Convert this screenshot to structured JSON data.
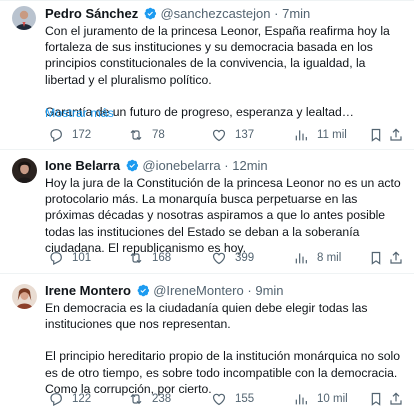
{
  "tweets": [
    {
      "name": "Pedro Sánchez",
      "handle": "@sanchezcastejon",
      "separator": "·",
      "time": "7min",
      "paragraphs": [
        "Con el juramento de la princesa Leonor, España reafirma hoy la fortaleza de sus instituciones y su democracia basada en los principios constitucionales de la convivencia, la igualdad, la libertad y el pluralismo político.",
        "Garantía de un futuro de progreso, esperanza y lealtad…"
      ],
      "show_more": "Mostrar más",
      "replies": "172",
      "retweets": "78",
      "likes": "137",
      "views": "11 mil"
    },
    {
      "name": "Ione Belarra",
      "handle": "@ionebelarra",
      "separator": "·",
      "time": "12min",
      "paragraphs": [
        "Hoy la jura de la Constitución de la princesa Leonor no es un acto protocolario más. La monarquía busca perpetuarse en las próximas décadas y nosotras aspiramos a que lo antes posible todas las instituciones del Estado se deban a la soberanía ciudadana. El republicanismo es hoy."
      ],
      "replies": "101",
      "retweets": "168",
      "likes": "399",
      "views": "8 mil"
    },
    {
      "name": "Irene Montero",
      "handle": "@IreneMontero",
      "separator": "·",
      "time": "9min",
      "paragraphs": [
        "En democracia es la ciudadanía quien debe elegir todas las instituciones que nos representan.",
        "El principio hereditario propio de la institución monárquica no solo es de otro tiempo, es sobre todo incompatible con la democracia. Como la corrupción, por cierto."
      ],
      "replies": "122",
      "retweets": "238",
      "likes": "155",
      "views": "10 mil"
    }
  ],
  "colors": {
    "text": "#0f1419",
    "muted": "#536471",
    "link": "#1d9bf0",
    "verified": "#1d9bf0",
    "divider": "#eff3f4"
  },
  "icons": [
    "verified-badge-icon",
    "reply-icon",
    "retweet-icon",
    "like-icon",
    "views-icon",
    "bookmark-icon",
    "share-icon"
  ]
}
